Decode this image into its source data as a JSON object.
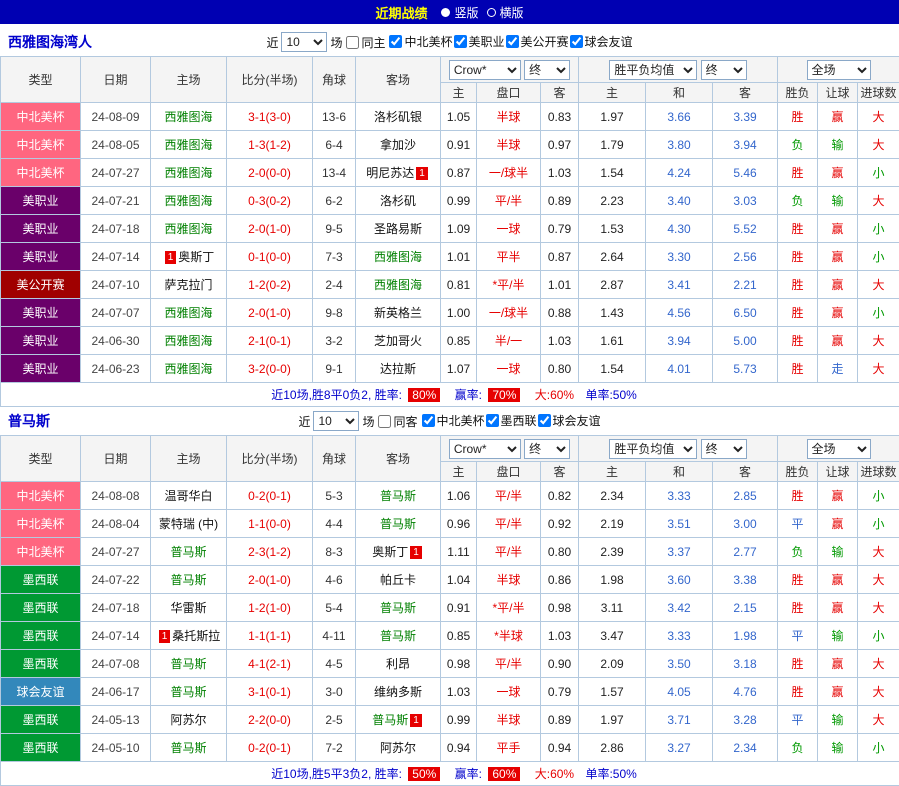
{
  "top_bar": {
    "title": "近期战绩",
    "options": [
      {
        "label": "竖版",
        "selected": true
      },
      {
        "label": "横版",
        "selected": false
      }
    ]
  },
  "colors": {
    "topbar_blue": "#0000B2",
    "accent_red": "#E60000",
    "avg_blue": "#3366CC",
    "league": {
      "中北美杯": "#FF6680",
      "美职业": "#6A006A",
      "美公开赛": "#A00000",
      "墨西联": "#009933",
      "球会友谊": "#3388BB"
    },
    "outcome": {
      "胜": "#E60000",
      "平": "#3366CC",
      "负": "#009900",
      "赢": "#E60000",
      "走": "#3366CC",
      "输": "#009900",
      "大": "#E60000",
      "小": "#009900"
    }
  },
  "sections": [
    {
      "team_name": "西雅图海湾人",
      "filter": {
        "prefix": "近",
        "count": "10",
        "suffix": "场",
        "same_side": {
          "label": "同主",
          "checked": false
        },
        "leagues": [
          {
            "label": "中北美杯",
            "checked": true
          },
          {
            "label": "美职业",
            "checked": true
          },
          {
            "label": "美公开赛",
            "checked": true
          },
          {
            "label": "球会友谊",
            "checked": true
          }
        ]
      },
      "table": {
        "columns": {
          "type": "类型",
          "date": "日期",
          "home": "主场",
          "score": "比分(半场)",
          "corner": "角球",
          "away": "客场",
          "odds_select": "Crow*",
          "final1": "终",
          "avg_label": "胜平负均值",
          "final2": "终",
          "scope_select": "全场",
          "sub_headers": [
            "主",
            "盘口",
            "客",
            "主",
            "和",
            "客",
            "胜负",
            "让球",
            "进球数"
          ]
        },
        "rows": [
          {
            "league": "中北美杯",
            "date": "24-08-09",
            "home": "西雅图海",
            "home_focus": true,
            "home_card": "",
            "score": "3-1(3-0)",
            "corner": "13-6",
            "away": "洛杉矶银",
            "away_focus": false,
            "away_card": "",
            "odds_home": "1.05",
            "handicap": "半球",
            "odds_away": "0.83",
            "avg_home": "1.97",
            "avg_draw": "3.66",
            "avg_away": "3.39",
            "result": "胜",
            "hcap_result": "赢",
            "goal_result": "大"
          },
          {
            "league": "中北美杯",
            "date": "24-08-05",
            "home": "西雅图海",
            "home_focus": true,
            "home_card": "",
            "score": "1-3(1-2)",
            "corner": "6-4",
            "away": "拿加沙",
            "away_focus": false,
            "away_card": "",
            "odds_home": "0.91",
            "handicap": "半球",
            "odds_away": "0.97",
            "avg_home": "1.79",
            "avg_draw": "3.80",
            "avg_away": "3.94",
            "result": "负",
            "hcap_result": "输",
            "goal_result": "大"
          },
          {
            "league": "中北美杯",
            "date": "24-07-27",
            "home": "西雅图海",
            "home_focus": true,
            "home_card": "",
            "score": "2-0(0-0)",
            "corner": "13-4",
            "away": "明尼苏达",
            "away_focus": false,
            "away_card": "1",
            "odds_home": "0.87",
            "handicap": "一/球半",
            "odds_away": "1.03",
            "avg_home": "1.54",
            "avg_draw": "4.24",
            "avg_away": "5.46",
            "result": "胜",
            "hcap_result": "赢",
            "goal_result": "小"
          },
          {
            "league": "美职业",
            "date": "24-07-21",
            "home": "西雅图海",
            "home_focus": true,
            "home_card": "",
            "score": "0-3(0-2)",
            "corner": "6-2",
            "away": "洛杉矶",
            "away_focus": false,
            "away_card": "",
            "odds_home": "0.99",
            "handicap": "平/半",
            "odds_away": "0.89",
            "avg_home": "2.23",
            "avg_draw": "3.40",
            "avg_away": "3.03",
            "result": "负",
            "hcap_result": "输",
            "goal_result": "大"
          },
          {
            "league": "美职业",
            "date": "24-07-18",
            "home": "西雅图海",
            "home_focus": true,
            "home_card": "",
            "score": "2-0(1-0)",
            "corner": "9-5",
            "away": "圣路易斯",
            "away_focus": false,
            "away_card": "",
            "odds_home": "1.09",
            "handicap": "一球",
            "odds_away": "0.79",
            "avg_home": "1.53",
            "avg_draw": "4.30",
            "avg_away": "5.52",
            "result": "胜",
            "hcap_result": "赢",
            "goal_result": "小"
          },
          {
            "league": "美职业",
            "date": "24-07-14",
            "home": "奥斯丁",
            "home_focus": false,
            "home_card": "1",
            "score": "0-1(0-0)",
            "corner": "7-3",
            "away": "西雅图海",
            "away_focus": true,
            "away_card": "",
            "odds_home": "1.01",
            "handicap": "平半",
            "odds_away": "0.87",
            "avg_home": "2.64",
            "avg_draw": "3.30",
            "avg_away": "2.56",
            "result": "胜",
            "hcap_result": "赢",
            "goal_result": "小"
          },
          {
            "league": "美公开赛",
            "date": "24-07-10",
            "home": "萨克拉门",
            "home_focus": false,
            "home_card": "",
            "score": "1-2(0-2)",
            "corner": "2-4",
            "away": "西雅图海",
            "away_focus": true,
            "away_card": "",
            "odds_home": "0.81",
            "handicap": "*平/半",
            "odds_away": "1.01",
            "avg_home": "2.87",
            "avg_draw": "3.41",
            "avg_away": "2.21",
            "result": "胜",
            "hcap_result": "赢",
            "goal_result": "大"
          },
          {
            "league": "美职业",
            "date": "24-07-07",
            "home": "西雅图海",
            "home_focus": true,
            "home_card": "",
            "score": "2-0(1-0)",
            "corner": "9-8",
            "away": "新英格兰",
            "away_focus": false,
            "away_card": "",
            "odds_home": "1.00",
            "handicap": "一/球半",
            "odds_away": "0.88",
            "avg_home": "1.43",
            "avg_draw": "4.56",
            "avg_away": "6.50",
            "result": "胜",
            "hcap_result": "赢",
            "goal_result": "小"
          },
          {
            "league": "美职业",
            "date": "24-06-30",
            "home": "西雅图海",
            "home_focus": true,
            "home_card": "",
            "score": "2-1(0-1)",
            "corner": "3-2",
            "away": "芝加哥火",
            "away_focus": false,
            "away_card": "",
            "odds_home": "0.85",
            "handicap": "半/一",
            "odds_away": "1.03",
            "avg_home": "1.61",
            "avg_draw": "3.94",
            "avg_away": "5.00",
            "result": "胜",
            "hcap_result": "赢",
            "goal_result": "大"
          },
          {
            "league": "美职业",
            "date": "24-06-23",
            "home": "西雅图海",
            "home_focus": true,
            "home_card": "",
            "score": "3-2(0-0)",
            "corner": "9-1",
            "away": "达拉斯",
            "away_focus": false,
            "away_card": "",
            "odds_home": "1.07",
            "handicap": "一球",
            "odds_away": "0.80",
            "avg_home": "1.54",
            "avg_draw": "4.01",
            "avg_away": "5.73",
            "result": "胜",
            "hcap_result": "走",
            "goal_result": "大"
          }
        ],
        "summary": {
          "text": "近10场,胜8平0负2, 胜率:",
          "win_rate": "80%",
          "mid": "赢率:",
          "hcap_rate": "70%",
          "big": "大:60%",
          "single": "单率:50%"
        }
      }
    },
    {
      "team_name": "普马斯",
      "filter": {
        "prefix": "近",
        "count": "10",
        "suffix": "场",
        "same_side": {
          "label": "同客",
          "checked": false
        },
        "leagues": [
          {
            "label": "中北美杯",
            "checked": true
          },
          {
            "label": "墨西联",
            "checked": true
          },
          {
            "label": "球会友谊",
            "checked": true
          }
        ]
      },
      "table": {
        "columns": {
          "type": "类型",
          "date": "日期",
          "home": "主场",
          "score": "比分(半场)",
          "corner": "角球",
          "away": "客场",
          "odds_select": "Crow*",
          "final1": "终",
          "avg_label": "胜平负均值",
          "final2": "终",
          "scope_select": "全场",
          "sub_headers": [
            "主",
            "盘口",
            "客",
            "主",
            "和",
            "客",
            "胜负",
            "让球",
            "进球数"
          ]
        },
        "rows": [
          {
            "league": "中北美杯",
            "date": "24-08-08",
            "home": "温哥华白",
            "home_focus": false,
            "home_card": "",
            "score": "0-2(0-1)",
            "corner": "5-3",
            "away": "普马斯",
            "away_focus": true,
            "away_card": "",
            "odds_home": "1.06",
            "handicap": "平/半",
            "odds_away": "0.82",
            "avg_home": "2.34",
            "avg_draw": "3.33",
            "avg_away": "2.85",
            "result": "胜",
            "hcap_result": "赢",
            "goal_result": "小"
          },
          {
            "league": "中北美杯",
            "date": "24-08-04",
            "home": "蒙特瑞 (中)",
            "home_focus": false,
            "home_card": "",
            "score": "1-1(0-0)",
            "corner": "4-4",
            "away": "普马斯",
            "away_focus": true,
            "away_card": "",
            "odds_home": "0.96",
            "handicap": "平/半",
            "odds_away": "0.92",
            "avg_home": "2.19",
            "avg_draw": "3.51",
            "avg_away": "3.00",
            "result": "平",
            "hcap_result": "赢",
            "goal_result": "小"
          },
          {
            "league": "中北美杯",
            "date": "24-07-27",
            "home": "普马斯",
            "home_focus": true,
            "home_card": "",
            "score": "2-3(1-2)",
            "corner": "8-3",
            "away": "奥斯丁",
            "away_focus": false,
            "away_card": "1",
            "odds_home": "1.11",
            "handicap": "平/半",
            "odds_away": "0.80",
            "avg_home": "2.39",
            "avg_draw": "3.37",
            "avg_away": "2.77",
            "result": "负",
            "hcap_result": "输",
            "goal_result": "大"
          },
          {
            "league": "墨西联",
            "date": "24-07-22",
            "home": "普马斯",
            "home_focus": true,
            "home_card": "",
            "score": "2-0(1-0)",
            "corner": "4-6",
            "away": "帕丘卡",
            "away_focus": false,
            "away_card": "",
            "odds_home": "1.04",
            "handicap": "半球",
            "odds_away": "0.86",
            "avg_home": "1.98",
            "avg_draw": "3.60",
            "avg_away": "3.38",
            "result": "胜",
            "hcap_result": "赢",
            "goal_result": "大"
          },
          {
            "league": "墨西联",
            "date": "24-07-18",
            "home": "华雷斯",
            "home_focus": false,
            "home_card": "",
            "score": "1-2(1-0)",
            "corner": "5-4",
            "away": "普马斯",
            "away_focus": true,
            "away_card": "",
            "odds_home": "0.91",
            "handicap": "*平/半",
            "odds_away": "0.98",
            "avg_home": "3.11",
            "avg_draw": "3.42",
            "avg_away": "2.15",
            "result": "胜",
            "hcap_result": "赢",
            "goal_result": "大"
          },
          {
            "league": "墨西联",
            "date": "24-07-14",
            "home": "桑托斯拉",
            "home_focus": false,
            "home_card": "1",
            "score": "1-1(1-1)",
            "corner": "4-11",
            "away": "普马斯",
            "away_focus": true,
            "away_card": "",
            "odds_home": "0.85",
            "handicap": "*半球",
            "odds_away": "1.03",
            "avg_home": "3.47",
            "avg_draw": "3.33",
            "avg_away": "1.98",
            "result": "平",
            "hcap_result": "输",
            "goal_result": "小"
          },
          {
            "league": "墨西联",
            "date": "24-07-08",
            "home": "普马斯",
            "home_focus": true,
            "home_card": "",
            "score": "4-1(2-1)",
            "corner": "4-5",
            "away": "利昂",
            "away_focus": false,
            "away_card": "",
            "odds_home": "0.98",
            "handicap": "平/半",
            "odds_away": "0.90",
            "avg_home": "2.09",
            "avg_draw": "3.50",
            "avg_away": "3.18",
            "result": "胜",
            "hcap_result": "赢",
            "goal_result": "大"
          },
          {
            "league": "球会友谊",
            "date": "24-06-17",
            "home": "普马斯",
            "home_focus": true,
            "home_card": "",
            "score": "3-1(0-1)",
            "corner": "3-0",
            "away": "维纳多斯",
            "away_focus": false,
            "away_card": "",
            "odds_home": "1.03",
            "handicap": "一球",
            "odds_away": "0.79",
            "avg_home": "1.57",
            "avg_draw": "4.05",
            "avg_away": "4.76",
            "result": "胜",
            "hcap_result": "赢",
            "goal_result": "大"
          },
          {
            "league": "墨西联",
            "date": "24-05-13",
            "home": "阿苏尔",
            "home_focus": false,
            "home_card": "",
            "score": "2-2(0-0)",
            "corner": "2-5",
            "away": "普马斯",
            "away_focus": true,
            "away_card": "1",
            "odds_home": "0.99",
            "handicap": "半球",
            "odds_away": "0.89",
            "avg_home": "1.97",
            "avg_draw": "3.71",
            "avg_away": "3.28",
            "result": "平",
            "hcap_result": "输",
            "goal_result": "大"
          },
          {
            "league": "墨西联",
            "date": "24-05-10",
            "home": "普马斯",
            "home_focus": true,
            "home_card": "",
            "score": "0-2(0-1)",
            "corner": "7-2",
            "away": "阿苏尔",
            "away_focus": false,
            "away_card": "",
            "odds_home": "0.94",
            "handicap": "平手",
            "odds_away": "0.94",
            "avg_home": "2.86",
            "avg_draw": "3.27",
            "avg_away": "2.34",
            "result": "负",
            "hcap_result": "输",
            "goal_result": "小"
          }
        ],
        "summary": {
          "text": "近10场,胜5平3负2, 胜率:",
          "win_rate": "50%",
          "mid": "赢率:",
          "hcap_rate": "60%",
          "big": "大:60%",
          "single": "单率:50%"
        }
      }
    }
  ]
}
